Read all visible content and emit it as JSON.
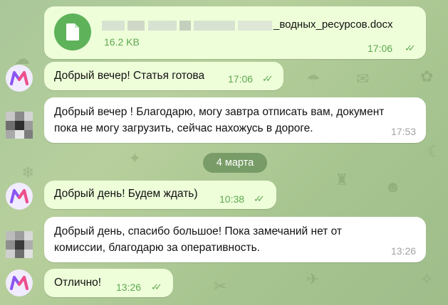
{
  "colors": {
    "outgoing_bubble": "#eefed9",
    "incoming_bubble": "#ffffff",
    "accent_green": "#5ea852",
    "date_pill": "#4c7642"
  },
  "file_message": {
    "icon": "document-icon",
    "filename": "_водных_ресурсов.docx",
    "size": "16.2 KB",
    "time": "17:06"
  },
  "messages": [
    {
      "direction": "out",
      "text": "Добрый вечер! Статья готова",
      "time": "17:06"
    },
    {
      "direction": "in",
      "text_lines": [
        "Добрый вечер ! Благодарю, могу завтра отписать вам, документ",
        "пока не могу загрузить, сейчас нахожусь в дороге."
      ],
      "time": "17:53"
    },
    {
      "direction": "out",
      "text": "Добрый день! Будем ждать)",
      "time": "10:38"
    },
    {
      "direction": "in",
      "text_lines": [
        "Добрый день, спасибо большое! Пока замечаний нет от",
        "комиссии, благодарю за оперативность."
      ],
      "time": "13:26"
    },
    {
      "direction": "out",
      "text": "Отлично!",
      "time": "13:26"
    }
  ],
  "date_separator": "4 марта",
  "read_ticks": "✓✓"
}
